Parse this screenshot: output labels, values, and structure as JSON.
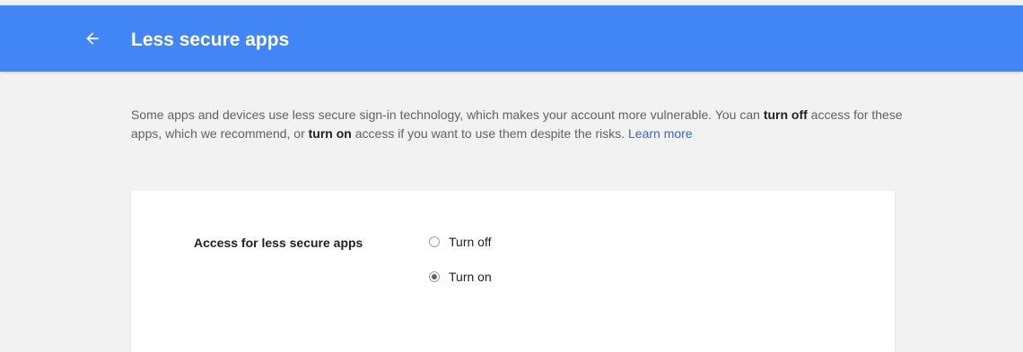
{
  "header": {
    "title": "Less secure apps",
    "back_icon": "arrow-left-icon"
  },
  "description": {
    "part1": "Some apps and devices use less secure sign-in technology, which makes your account more vulnerable. You can ",
    "bold1": "turn off",
    "part2": " access for these apps, which we recommend, or ",
    "bold2": "turn on",
    "part3": " access if you want to use them despite the risks. ",
    "link": "Learn more"
  },
  "setting": {
    "label": "Access for less secure apps",
    "options": [
      {
        "label": "Turn off",
        "selected": false
      },
      {
        "label": "Turn on",
        "selected": true
      }
    ]
  },
  "colors": {
    "header_bg": "#4285f4",
    "page_bg": "#f2f2f2",
    "link": "#3367d6"
  }
}
